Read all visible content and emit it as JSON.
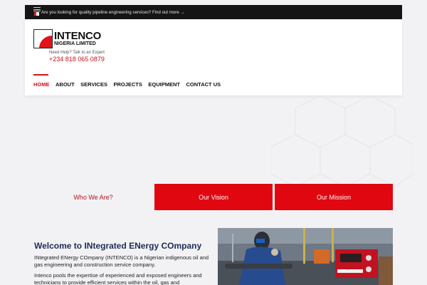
{
  "topbar": {
    "message": "Are you looking for quality pipeline engineering services? Find out more →"
  },
  "header": {
    "brand_name": "INTENCO",
    "brand_sub": "NIGERIA LIMITED",
    "help_text": "Need Help? Talk to an Expert",
    "phone": "+234 818 065 0879",
    "accent_color": "#d20f17"
  },
  "nav": {
    "items": [
      {
        "label": "HOME"
      },
      {
        "label": "ABOUT"
      },
      {
        "label": "SERVICES"
      },
      {
        "label": "PROJECTS"
      },
      {
        "label": "EQUIPMENT"
      },
      {
        "label": "CONTACT US"
      }
    ],
    "active": "HOME"
  },
  "tabs": [
    {
      "label": "Who We Are?"
    },
    {
      "label": "Our Vision"
    },
    {
      "label": "Our Mission"
    }
  ],
  "welcome": {
    "title": "Welcome to INtegrated ENergy COmpany",
    "para1": "INtegrated ENergy COmpany (INTENCO) is a Nigerian indigenous oil and gas engineering and construction service company.",
    "para2": "Intenco pools the expertise of experienced and exposed engineers and technicians to provide efficient services within the oil, gas and"
  },
  "icons": {
    "menu": "hamburger-icon",
    "flag": "flag-icon",
    "logo": "intenco-logo-icon"
  }
}
